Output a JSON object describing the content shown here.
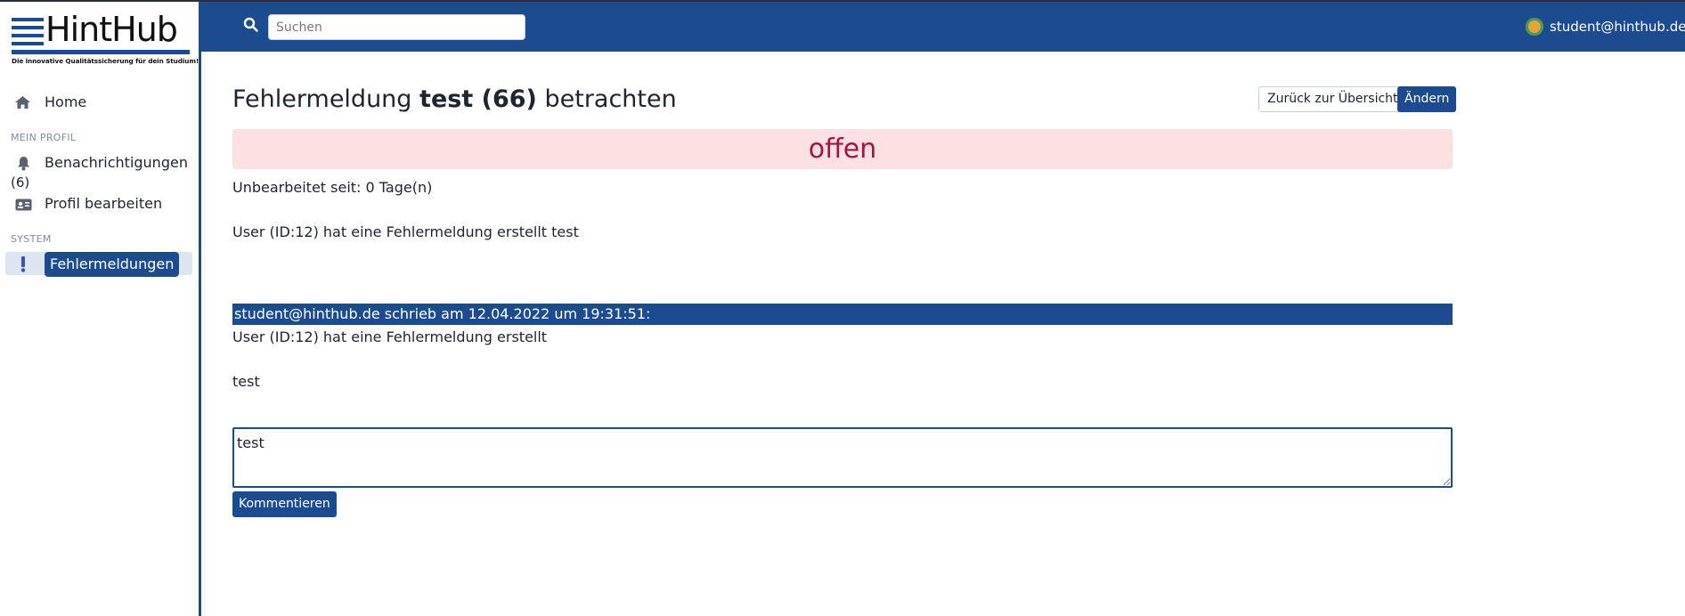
{
  "brand": {
    "name": "HintHub",
    "tagline": "Die innovative Qualitätssicherung für dein Studium!",
    "primary_color": "#1c4c8f"
  },
  "sidebar": {
    "home": {
      "label": "Home",
      "icon": "home-icon"
    },
    "section_profile": "MEIN PROFIL",
    "notifications": {
      "label": "Benachrichtigungen",
      "count": "(6)",
      "icon": "bell-icon"
    },
    "profile_edit": {
      "label": "Profil bearbeiten",
      "icon": "id-card-icon"
    },
    "section_system": "SYSTEM",
    "errors": {
      "label": "Fehlermeldungen",
      "icon": "exclamation-icon",
      "active": true
    }
  },
  "header": {
    "search_placeholder": "Suchen",
    "user_email": "student@hinthub.de"
  },
  "main": {
    "title_prefix": "Fehlermeldung",
    "title_bold": "test (66)",
    "title_suffix": "betrachten",
    "back_button": "Zurück zur Übersicht",
    "edit_button": "Ändern",
    "status": "offen",
    "status_color": "#a3163c",
    "unedited_since": "Unbearbeitet seit: 0 Tage(n)",
    "description": "User (ID:12) hat eine Fehlermeldung erstellt test",
    "comments": [
      {
        "header": "student@hinthub.de schrieb am 12.04.2022 um 19:31:51:",
        "line1": "User (ID:12) hat eine Fehlermeldung erstellt",
        "line2": "test"
      }
    ],
    "comment_input_value": "test",
    "comment_button": "Kommentieren"
  }
}
